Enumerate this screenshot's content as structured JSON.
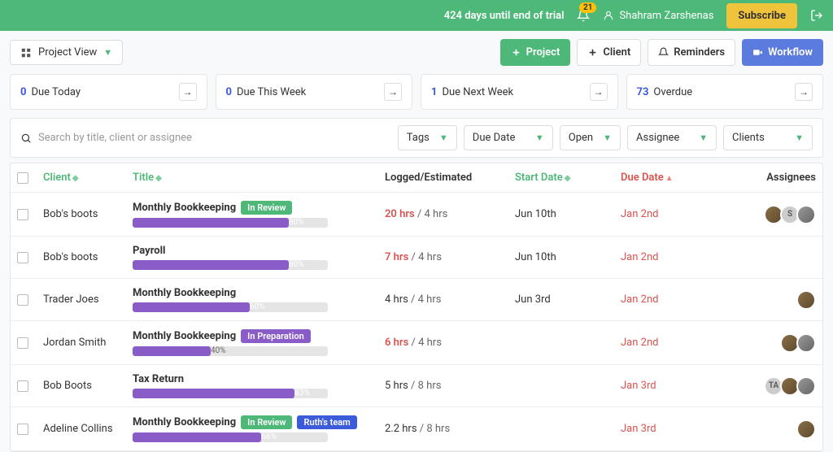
{
  "header": {
    "trial": "424 days until end of trial",
    "notifications": "21",
    "user": "Shahram Zarshenas",
    "subscribe": "Subscribe"
  },
  "toolbar": {
    "project_view": "Project View",
    "project": "Project",
    "client": "Client",
    "reminders": "Reminders",
    "workflow": "Workflow"
  },
  "summary": [
    {
      "count": "0",
      "label": "Due Today",
      "color": "blue"
    },
    {
      "count": "0",
      "label": "Due This Week",
      "color": "blue"
    },
    {
      "count": "1",
      "label": "Due Next Week",
      "color": "blue"
    },
    {
      "count": "73",
      "label": "Overdue",
      "color": "blue"
    }
  ],
  "search": {
    "placeholder": "Search by title, client or assignee"
  },
  "filters": {
    "tags": "Tags",
    "due_date": "Due Date",
    "open": "Open",
    "assignee": "Assignee",
    "clients": "Clients"
  },
  "columns": {
    "client": "Client",
    "title": "Title",
    "logged": "Logged/Estimated",
    "start": "Start Date",
    "due": "Due Date",
    "assignees": "Assignees"
  },
  "rows": [
    {
      "client": "Bob's boots",
      "title": "Monthly Bookkeeping",
      "tags": [
        {
          "label": "In Review",
          "style": "green"
        }
      ],
      "progress": 80,
      "logged": "20 hrs",
      "logged_over": true,
      "est": "4 hrs",
      "start": "Jun 10th",
      "due": "Jan 2nd",
      "avatars": [
        "img1",
        "S",
        "img2"
      ]
    },
    {
      "client": "Bob's boots",
      "title": "Payroll",
      "tags": [],
      "progress": 80,
      "logged": "7 hrs",
      "logged_over": true,
      "est": "4 hrs",
      "start": "Jun 10th",
      "due": "Jan 2nd",
      "avatars": []
    },
    {
      "client": "Trader Joes",
      "title": "Monthly Bookkeeping",
      "tags": [],
      "progress": 60,
      "logged": "4 hrs",
      "logged_over": false,
      "est": "4 hrs",
      "start": "Jun 3rd",
      "due": "Jan 2nd",
      "avatars": [
        "img1"
      ]
    },
    {
      "client": "Jordan Smith",
      "title": "Monthly Bookkeeping",
      "tags": [
        {
          "label": "In Preparation",
          "style": "purple"
        }
      ],
      "progress": 40,
      "logged": "6 hrs",
      "logged_over": true,
      "est": "4 hrs",
      "start": "",
      "due": "Jan 2nd",
      "avatars": [
        "img1",
        "img2"
      ]
    },
    {
      "client": "Bob Boots",
      "title": "Tax Return",
      "tags": [],
      "progress": 83,
      "logged": "5 hrs",
      "logged_over": false,
      "est": "8 hrs",
      "start": "",
      "due": "Jan 3rd",
      "avatars": [
        "TA",
        "img1",
        "img2"
      ]
    },
    {
      "client": "Adeline Collins",
      "title": "Monthly Bookkeeping",
      "tags": [
        {
          "label": "In Review",
          "style": "green"
        },
        {
          "label": "Ruth's team",
          "style": "blue"
        }
      ],
      "progress": 66,
      "logged": "2.2 hrs",
      "logged_over": false,
      "est": "8 hrs",
      "start": "",
      "due": "Jan 3rd",
      "avatars": [
        "img1"
      ]
    }
  ]
}
